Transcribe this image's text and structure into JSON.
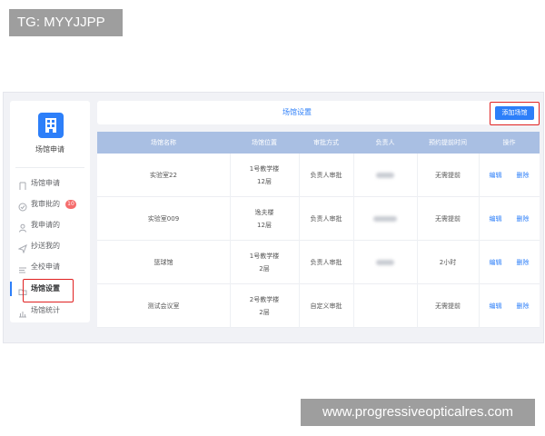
{
  "watermarks": {
    "top": "TG: MYYJJPP",
    "bottom": "www.progressiveopticalres.com"
  },
  "sidebar": {
    "brand_label": "场馆申请",
    "items": [
      {
        "label": "场馆申请",
        "icon": "bracket-icon"
      },
      {
        "label": "我审批的",
        "icon": "check-circle-icon",
        "badge": "10"
      },
      {
        "label": "我申请的",
        "icon": "user-icon"
      },
      {
        "label": "抄送我的",
        "icon": "send-icon"
      },
      {
        "label": "全校申请",
        "icon": "list-icon"
      },
      {
        "label": "场馆设置",
        "icon": "folder-icon",
        "active": true
      },
      {
        "label": "场馆统计",
        "icon": "chart-icon"
      }
    ]
  },
  "header": {
    "title": "场馆设置",
    "add_button": "添加场馆"
  },
  "table": {
    "columns": [
      "场馆名称",
      "场馆位置",
      "审批方式",
      "负责人",
      "预约提前时间",
      "操作"
    ],
    "rows": [
      {
        "name": "实验室22",
        "location_line1": "1号教学楼",
        "location_line2": "12层",
        "approval": "负责人审批",
        "owner": "",
        "advance": "无需提前",
        "edit": "编辑",
        "delete": "删除"
      },
      {
        "name": "实验室009",
        "location_line1": "逸夫楼",
        "location_line2": "12层",
        "approval": "负责人审批",
        "owner": "",
        "advance": "无需提前",
        "edit": "编辑",
        "delete": "删除"
      },
      {
        "name": "篮球馆",
        "location_line1": "1号教学楼",
        "location_line2": "2层",
        "approval": "负责人审批",
        "owner": "",
        "advance": "2小时",
        "edit": "编辑",
        "delete": "删除"
      },
      {
        "name": "测试会议室",
        "location_line1": "2号教学楼",
        "location_line2": "2层",
        "approval": "自定义审批",
        "owner": "",
        "advance": "无需提前",
        "edit": "编辑",
        "delete": "删除"
      }
    ]
  },
  "colors": {
    "accent": "#2d7ff9",
    "table_header": "#a9bfe3",
    "highlight": "#e02020",
    "badge": "#f56c6c"
  }
}
